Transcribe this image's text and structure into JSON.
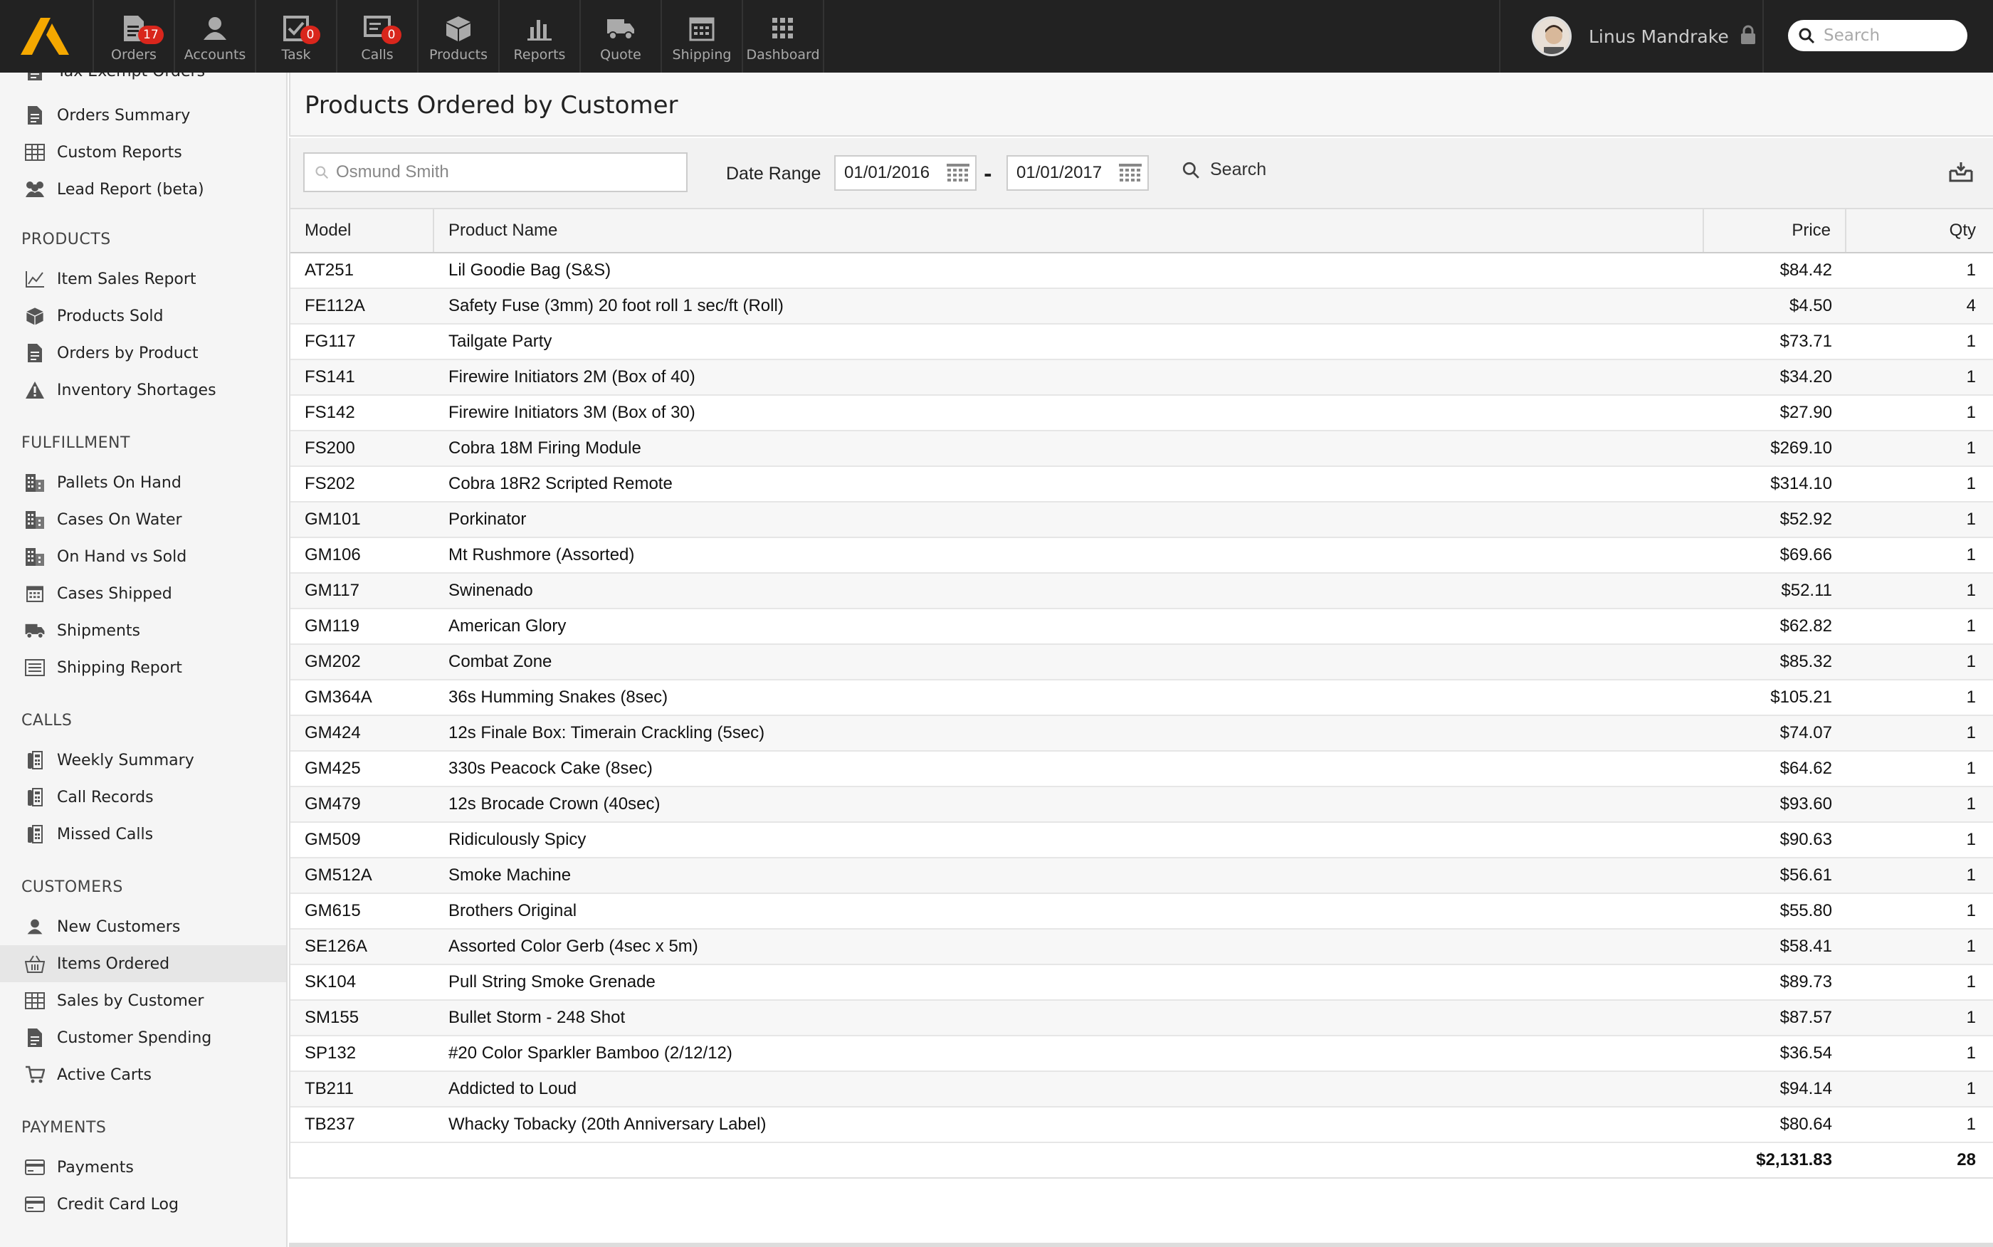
{
  "topnav": {
    "items": [
      {
        "label": "Orders",
        "badge": "17",
        "icon": "orders-icon"
      },
      {
        "label": "Accounts",
        "badge": "",
        "icon": "accounts-icon"
      },
      {
        "label": "Task",
        "badge": "0",
        "icon": "task-icon"
      },
      {
        "label": "Calls",
        "badge": "0",
        "icon": "calls-icon"
      },
      {
        "label": "Products",
        "badge": "",
        "icon": "products-icon"
      },
      {
        "label": "Reports",
        "badge": "",
        "icon": "reports-icon"
      },
      {
        "label": "Quote",
        "badge": "",
        "icon": "truck-icon"
      },
      {
        "label": "Shipping",
        "badge": "",
        "icon": "calendar-icon"
      },
      {
        "label": "Dashboard",
        "badge": "",
        "icon": "grid-icon"
      }
    ],
    "user_name": "Linus Mandrake",
    "search_placeholder": "Search",
    "accent": "#f5a800",
    "badge_color": "#d9261c"
  },
  "sidebar": {
    "partial_item": "Tax Exempt Orders",
    "items_top": [
      {
        "label": "Orders Summary",
        "icon": "document-icon"
      },
      {
        "label": "Custom Reports",
        "icon": "table-icon"
      },
      {
        "label": "Lead Report (beta)",
        "icon": "group-icon"
      }
    ],
    "sections": [
      {
        "heading": "PRODUCTS",
        "items": [
          {
            "label": "Item Sales Report",
            "icon": "line-chart-icon"
          },
          {
            "label": "Products Sold",
            "icon": "box-icon"
          },
          {
            "label": "Orders by Product",
            "icon": "document-icon"
          },
          {
            "label": "Inventory Shortages",
            "icon": "warning-icon"
          }
        ]
      },
      {
        "heading": "FULFILLMENT",
        "items": [
          {
            "label": "Pallets On Hand",
            "icon": "building-icon"
          },
          {
            "label": "Cases On Water",
            "icon": "building-icon"
          },
          {
            "label": "On Hand vs Sold",
            "icon": "building-icon"
          },
          {
            "label": "Cases Shipped",
            "icon": "calendar-icon"
          },
          {
            "label": "Shipments",
            "icon": "truck-icon"
          },
          {
            "label": "Shipping Report",
            "icon": "list-icon"
          }
        ]
      },
      {
        "heading": "CALLS",
        "items": [
          {
            "label": "Weekly Summary",
            "icon": "phone-icon"
          },
          {
            "label": "Call Records",
            "icon": "phone-icon"
          },
          {
            "label": "Missed Calls",
            "icon": "phone-icon"
          }
        ]
      },
      {
        "heading": "CUSTOMERS",
        "items": [
          {
            "label": "New Customers",
            "icon": "user-icon"
          },
          {
            "label": "Items Ordered",
            "icon": "basket-icon",
            "active": true
          },
          {
            "label": "Sales by Customer",
            "icon": "table-icon"
          },
          {
            "label": "Customer Spending",
            "icon": "document-icon"
          },
          {
            "label": "Active Carts",
            "icon": "cart-icon"
          }
        ]
      },
      {
        "heading": "PAYMENTS",
        "items": [
          {
            "label": "Payments",
            "icon": "card-icon"
          },
          {
            "label": "Credit Card Log",
            "icon": "card-icon"
          }
        ]
      }
    ]
  },
  "main": {
    "title": "Products Ordered by Customer",
    "customer_value": "Osmund Smith",
    "date_range_label": "Date Range",
    "date_from": "01/01/2016",
    "date_separator": "-",
    "date_to": "01/01/2017",
    "search_label": "Search",
    "table": {
      "columns": [
        "Model",
        "Product Name",
        "Price",
        "Qty"
      ],
      "rows": [
        [
          "AT251",
          "Lil Goodie Bag (S&S)",
          "$84.42",
          "1"
        ],
        [
          "FE112A",
          "Safety Fuse (3mm) 20 foot roll 1 sec/ft (Roll)",
          "$4.50",
          "4"
        ],
        [
          "FG117",
          "Tailgate Party",
          "$73.71",
          "1"
        ],
        [
          "FS141",
          "Firewire Initiators 2M (Box of 40)",
          "$34.20",
          "1"
        ],
        [
          "FS142",
          "Firewire Initiators 3M (Box of 30)",
          "$27.90",
          "1"
        ],
        [
          "FS200",
          "Cobra 18M Firing Module",
          "$269.10",
          "1"
        ],
        [
          "FS202",
          "Cobra 18R2 Scripted Remote",
          "$314.10",
          "1"
        ],
        [
          "GM101",
          "Porkinator",
          "$52.92",
          "1"
        ],
        [
          "GM106",
          "Mt Rushmore (Assorted)",
          "$69.66",
          "1"
        ],
        [
          "GM117",
          "Swinenado",
          "$52.11",
          "1"
        ],
        [
          "GM119",
          "American Glory",
          "$62.82",
          "1"
        ],
        [
          "GM202",
          "Combat Zone",
          "$85.32",
          "1"
        ],
        [
          "GM364A",
          "36s Humming Snakes (8sec)",
          "$105.21",
          "1"
        ],
        [
          "GM424",
          "12s Finale Box: Timerain Crackling (5sec)",
          "$74.07",
          "1"
        ],
        [
          "GM425",
          "330s Peacock Cake (8sec)",
          "$64.62",
          "1"
        ],
        [
          "GM479",
          "12s Brocade Crown (40sec)",
          "$93.60",
          "1"
        ],
        [
          "GM509",
          "Ridiculously Spicy",
          "$90.63",
          "1"
        ],
        [
          "GM512A",
          "Smoke Machine",
          "$56.61",
          "1"
        ],
        [
          "GM615",
          "Brothers Original",
          "$55.80",
          "1"
        ],
        [
          "SE126A",
          "Assorted Color Gerb (4sec x 5m)",
          "$58.41",
          "1"
        ],
        [
          "SK104",
          "Pull String Smoke Grenade",
          "$89.73",
          "1"
        ],
        [
          "SM155",
          "Bullet Storm - 248 Shot",
          "$87.57",
          "1"
        ],
        [
          "SP132",
          "#20 Color Sparkler Bamboo (2/12/12)",
          "$36.54",
          "1"
        ],
        [
          "TB211",
          "Addicted to Loud",
          "$94.14",
          "1"
        ],
        [
          "TB237",
          "Whacky Tobacky (20th Anniversary Label)",
          "$80.64",
          "1"
        ]
      ],
      "total_price": "$2,131.83",
      "total_qty": "28"
    }
  }
}
